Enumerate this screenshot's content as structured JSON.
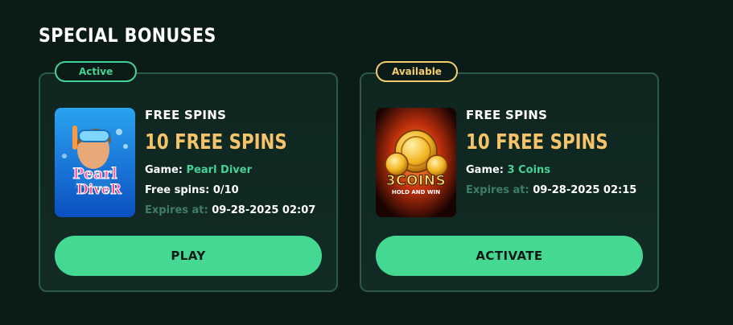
{
  "section": {
    "title": "SPECIAL BONUSES"
  },
  "cards": [
    {
      "badge": "Active",
      "kicker": "FREE SPINS",
      "amount": "10 FREE SPINS",
      "game_label": "Game:",
      "game_name": "Pearl Diver",
      "spins_label": "Free spins:",
      "spins_value": "0/10",
      "expires_label": "Expires at:",
      "expires_value": "09-28-2025 02:07",
      "thumb_logo_top": "Pearl",
      "thumb_logo_bottom": "DiveR",
      "button": "PLAY"
    },
    {
      "badge": "Available",
      "kicker": "FREE SPINS",
      "amount": "10 FREE SPINS",
      "game_label": "Game:",
      "game_name": "3 Coins",
      "expires_label": "Expires at:",
      "expires_value": "09-28-2025 02:15",
      "thumb_logo_top": "3COINS",
      "thumb_logo_bottom": "HOLD AND WIN",
      "button": "ACTIVATE"
    }
  ],
  "colors": {
    "background": "#0b1b17",
    "accent_green": "#45d893",
    "accent_gold": "#f5c46a",
    "badge_available": "#f2cf6b"
  }
}
